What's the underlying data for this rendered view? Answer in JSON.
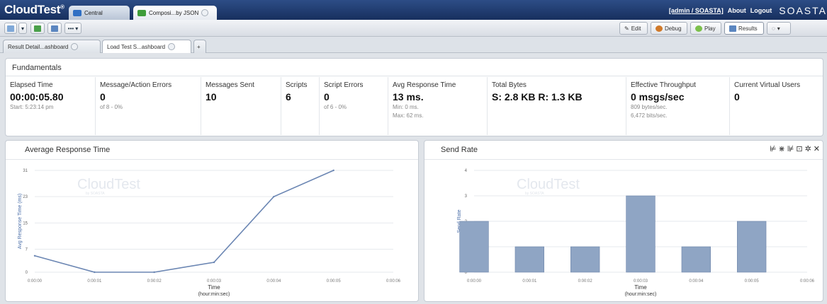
{
  "app": {
    "logo": "CloudTest",
    "logo_mark": "®",
    "tabs": [
      {
        "label": "Central"
      },
      {
        "label": "Composi...by JSON"
      }
    ],
    "user_link": "[admin / SOASTA]",
    "about": "About",
    "logout": "Logout",
    "brand": "SOASTA"
  },
  "toolbar": {
    "right_tabs": [
      {
        "label": "Edit"
      },
      {
        "label": "Debug"
      },
      {
        "label": "Play"
      },
      {
        "label": "Results"
      }
    ],
    "more_label": "•••"
  },
  "dashboard_tabs": [
    {
      "label": "Result Detail...ashboard"
    },
    {
      "label": "Load Test S...ashboard"
    },
    {
      "label": "+"
    }
  ],
  "fundamentals": {
    "title": "Fundamentals",
    "metrics": [
      {
        "label": "Elapsed Time",
        "value": "00:00:05.80",
        "sub1": "Start: 5:23:14 pm",
        "sub2": ""
      },
      {
        "label": "Message/Action Errors",
        "value": "0",
        "sub1": "of 8 - 0%",
        "sub2": ""
      },
      {
        "label": "Messages Sent",
        "value": "10",
        "sub1": "",
        "sub2": ""
      },
      {
        "label": "Scripts",
        "value": "6",
        "sub1": "",
        "sub2": ""
      },
      {
        "label": "Script Errors",
        "value": "0",
        "sub1": "of 6 - 0%",
        "sub2": ""
      },
      {
        "label": "Avg Response Time",
        "value": "13 ms.",
        "sub1": "Min: 0 ms.",
        "sub2": "Max: 62 ms."
      },
      {
        "label": "Total Bytes",
        "value": "S: 2.8 KB  R: 1.3 KB",
        "sub1": "",
        "sub2": ""
      },
      {
        "label": "Effective Throughput",
        "value": "0 msgs/sec",
        "sub1": "809 bytes/sec.",
        "sub2": "6,472 bits/sec."
      },
      {
        "label": "Current Virtual Users",
        "value": "0",
        "sub1": "",
        "sub2": ""
      }
    ]
  },
  "charts": {
    "avg_title": "Average Response Time",
    "send_title": "Send Rate",
    "watermark": "CloudTest",
    "watermark_sub": "by SOASTA"
  },
  "chart_data": [
    {
      "type": "line",
      "title": "Average Response Time",
      "xlabel": "Time",
      "xlabel_sub": "(hour:min:sec)",
      "ylabel": "Avg Response Time (ms)",
      "x": [
        "0:00:00",
        "0:00:01",
        "0:00:02",
        "0:00:03",
        "0:00:04",
        "0:00:05",
        "0:00:06"
      ],
      "x_ticks": [
        "0:00:00",
        "0:00:01",
        "0:00:02",
        "0:00:03",
        "0:00:04",
        "0:00:05",
        "0:00:06"
      ],
      "y_ticks": [
        0,
        7,
        15,
        23,
        31
      ],
      "ylim": [
        0,
        31
      ],
      "values": [
        5,
        0,
        0,
        3,
        23,
        31
      ],
      "color": "#6b86b3",
      "grid": true
    },
    {
      "type": "bar",
      "title": "Send Rate",
      "xlabel": "Time",
      "xlabel_sub": "(hour:min:sec)",
      "ylabel": "Send Rate",
      "categories": [
        "0:00:00",
        "0:00:01",
        "0:00:02",
        "0:00:03",
        "0:00:04",
        "0:00:05"
      ],
      "x_ticks": [
        "0:00:00",
        "0:00:01",
        "0:00:02",
        "0:00:03",
        "0:00:04",
        "0:00:05",
        "0:00:06"
      ],
      "y_ticks": [
        0,
        1,
        2,
        3,
        4
      ],
      "ylim": [
        0,
        4
      ],
      "values": [
        2,
        1,
        1,
        3,
        1,
        2
      ],
      "color": "#8fa5c4",
      "grid": true
    }
  ]
}
